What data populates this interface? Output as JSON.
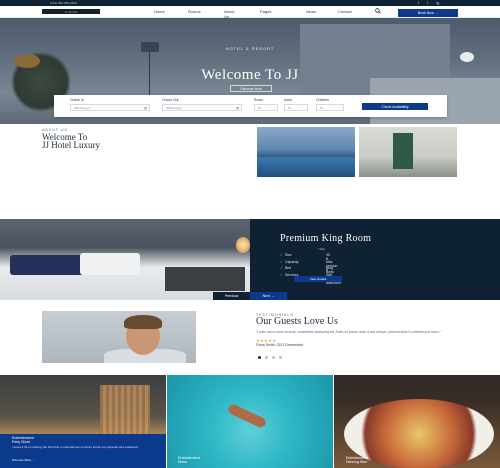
{
  "topbar": {
    "phone": "(123) 456-789-1230",
    "social": [
      "f",
      "t",
      "ig"
    ]
  },
  "header": {
    "logo_text": "JJ HOTEL",
    "nav": [
      "Home",
      "Rooms",
      "About Us",
      "Pages",
      "News",
      "Contact"
    ],
    "book_label": "Book Now →"
  },
  "hero": {
    "subtitle": "HOTEL & RESORT",
    "title": "Welcome To JJ",
    "button": "Discover Now"
  },
  "booking": {
    "fields": [
      {
        "label": "Check In",
        "value": "dd/mm/yyyy"
      },
      {
        "label": "Check Out",
        "value": "dd/mm/yyyy"
      },
      {
        "label": "Room",
        "value": "01"
      },
      {
        "label": "Adult",
        "value": "01"
      },
      {
        "label": "Children",
        "value": "01"
      }
    ],
    "button": "Check Availability"
  },
  "about": {
    "kicker": "ABOUT US",
    "title_line1": "Welcome To",
    "title_line2": "JJ Hotel Luxury"
  },
  "room": {
    "title": "Premium King Room",
    "price": "/ Day",
    "features": [
      {
        "k": "Size",
        "v": "30 ft"
      },
      {
        "k": "Capacity",
        "v": "Max persion 5"
      },
      {
        "k": "Bed",
        "v": "King Beds"
      },
      {
        "k": "Services",
        "v": "Wifi, Television, Bathroom"
      }
    ],
    "button": "View Details",
    "prev_label": "Previous",
    "next_label": "Next →"
  },
  "testimonials": {
    "kicker": "TESTIMONIALS",
    "title": "Our Guests Love Us",
    "quote": "\"Lorem ipsum dolor sit amet, consectetur adipiscing elit. Nulla, ex ipsum, dolor a non semper, placerat dolor in pharetra quis lacus.\"",
    "stars": "★★★★★",
    "name": "Fiona Smith, CEO Dreamotion"
  },
  "tiles": [
    {
      "title_line1": "Entertainment",
      "title_line2": "Party Show",
      "text": "I loved a hit on helping the first time in entertainment Instinct found out prepared and sustained.",
      "link": "Discover More →"
    },
    {
      "title_line1": "Entertainment",
      "title_line2": "Music"
    },
    {
      "title_line1": "Entertainment",
      "title_line2": "Dancing Nine"
    }
  ],
  "colors": {
    "navy": "#0f2233",
    "accent_blue": "#0b3a8c",
    "star": "#e5a826"
  }
}
